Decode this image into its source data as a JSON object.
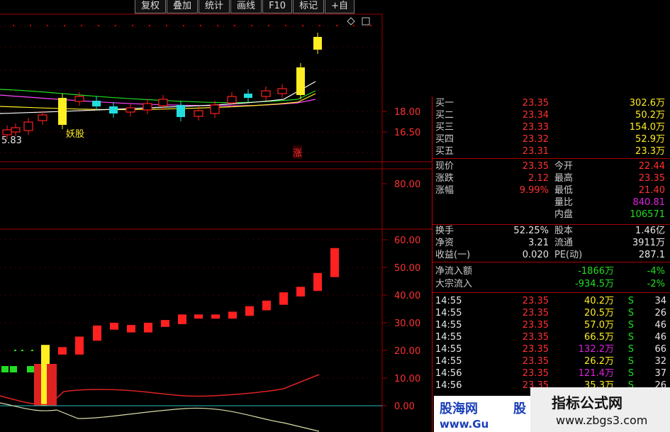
{
  "toolbar": {
    "items": [
      "复权",
      "叠加",
      "统计",
      "画线",
      "F10",
      "标记",
      "+自"
    ]
  },
  "colors": {
    "up": "#ff2020",
    "down": "#22dddd",
    "limit_up": "#ffee22",
    "grid": "#a00000",
    "ma1": "#ffffff",
    "ma2": "#ffee22",
    "ma3": "#ff44ff",
    "ma4": "#22dd22"
  },
  "icons": {
    "toolbar_diamond": "diamond-icon",
    "toolbar_box": "square-icon"
  },
  "chart_data": [
    {
      "type": "line",
      "name_hidden": "k-line",
      "y_ticks": [
        "18.00",
        "16.50"
      ],
      "annotations": [
        "妖股",
        "5.83",
        "涨"
      ],
      "note_price_low": "5.83"
    },
    {
      "type": "bar",
      "y_ticks": [
        "80.00"
      ]
    },
    {
      "type": "bar",
      "y_ticks": [
        "60.00",
        "50.00",
        "40.00",
        "30.00",
        "20.00",
        "10.00",
        "0.00"
      ],
      "values": [
        22,
        20,
        25,
        29,
        30,
        28,
        30,
        31,
        33,
        33,
        33,
        34,
        36,
        38,
        41,
        43,
        48,
        57
      ]
    }
  ],
  "quote": {
    "bids": [
      {
        "label": "买一",
        "price": "23.35",
        "vol": "302.6万"
      },
      {
        "label": "买二",
        "price": "23.34",
        "vol": "50.2万"
      },
      {
        "label": "买三",
        "price": "23.33",
        "vol": "154.0万"
      },
      {
        "label": "买四",
        "price": "23.32",
        "vol": "52.9万"
      },
      {
        "label": "买五",
        "price": "23.31",
        "vol": "23.3万"
      }
    ],
    "stats": [
      {
        "l1": "现价",
        "v1": "23.35",
        "l2": "今开",
        "v2": "22.44"
      },
      {
        "l1": "涨跌",
        "v1": "2.12",
        "l2": "最高",
        "v2": "23.35"
      },
      {
        "l1": "涨幅",
        "v1": "9.99%",
        "l2": "最低",
        "v2": "21.40"
      },
      {
        "l1": "",
        "v1": "",
        "l2": "量比",
        "v2": "840.81"
      },
      {
        "l1": "",
        "v1": "",
        "l2": "内盘",
        "v2": "106571"
      }
    ],
    "fund": [
      {
        "l1": "换手",
        "v1": "52.25%",
        "l2": "股本",
        "v2": "1.46亿"
      },
      {
        "l1": "净资",
        "v1": "3.21",
        "l2": "流通",
        "v2": "3911万"
      },
      {
        "l1": "收益(一)",
        "v1": "0.020",
        "l2": "PE(动)",
        "v2": "287.1"
      }
    ],
    "flows": [
      {
        "label": "净流入额",
        "value": "-1866万",
        "pct": "-4%"
      },
      {
        "label": "大宗流入",
        "value": "-934.5万",
        "pct": "-2%"
      }
    ],
    "ticks": [
      {
        "t": "14:55",
        "p": "23.35",
        "v": "40.2万",
        "s": "S",
        "n": "34"
      },
      {
        "t": "14:55",
        "p": "23.35",
        "v": "20.5万",
        "s": "S",
        "n": "26"
      },
      {
        "t": "14:55",
        "p": "23.35",
        "v": "57.0万",
        "s": "S",
        "n": "46"
      },
      {
        "t": "14:55",
        "p": "23.35",
        "v": "66.5万",
        "s": "S",
        "n": "46"
      },
      {
        "t": "14:55",
        "p": "23.35",
        "v": "132.2万",
        "s": "S",
        "n": "66"
      },
      {
        "t": "14:55",
        "p": "23.35",
        "v": "26.2万",
        "s": "S",
        "n": "32"
      },
      {
        "t": "14:56",
        "p": "23.35",
        "v": "121.4万",
        "s": "S",
        "n": "37"
      },
      {
        "t": "14:56",
        "p": "23.35",
        "v": "35.3万",
        "s": "S",
        "n": "26"
      }
    ]
  },
  "watermarks": {
    "left_line1": "股海网",
    "left_line1b": "股",
    "left_line2": "www.Gu",
    "right_name": "指标公式网",
    "right_url": "www.zbgs3.com"
  }
}
